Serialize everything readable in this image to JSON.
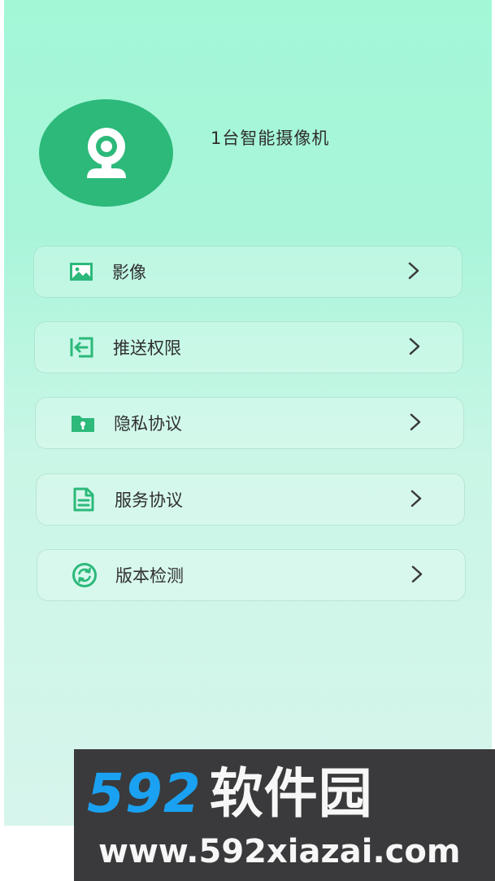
{
  "device": {
    "name": "1台智能摄像机",
    "avatar_icon": "camera-icon"
  },
  "menu": {
    "items": [
      {
        "id": "images",
        "label": "影像",
        "icon": "image-icon"
      },
      {
        "id": "push-permission",
        "label": "推送权限",
        "icon": "login-arrow-icon"
      },
      {
        "id": "privacy-policy",
        "label": "隐私协议",
        "icon": "lock-folder-icon"
      },
      {
        "id": "service-agreement",
        "label": "服务协议",
        "icon": "document-icon"
      },
      {
        "id": "version-check",
        "label": "版本检测",
        "icon": "refresh-icon"
      }
    ],
    "chevron_icon": "chevron-right-icon"
  },
  "watermark": {
    "number": "592",
    "brand": "软件园",
    "url": "www.592xiazai.com"
  },
  "colors": {
    "accent": "#2cb97a",
    "background_top": "#a3f7d7",
    "background_bottom": "#d7f5ec",
    "text": "#2f2f2f",
    "watermark_bg": "#3a3a3c",
    "watermark_blue": "#1aa1f1"
  }
}
